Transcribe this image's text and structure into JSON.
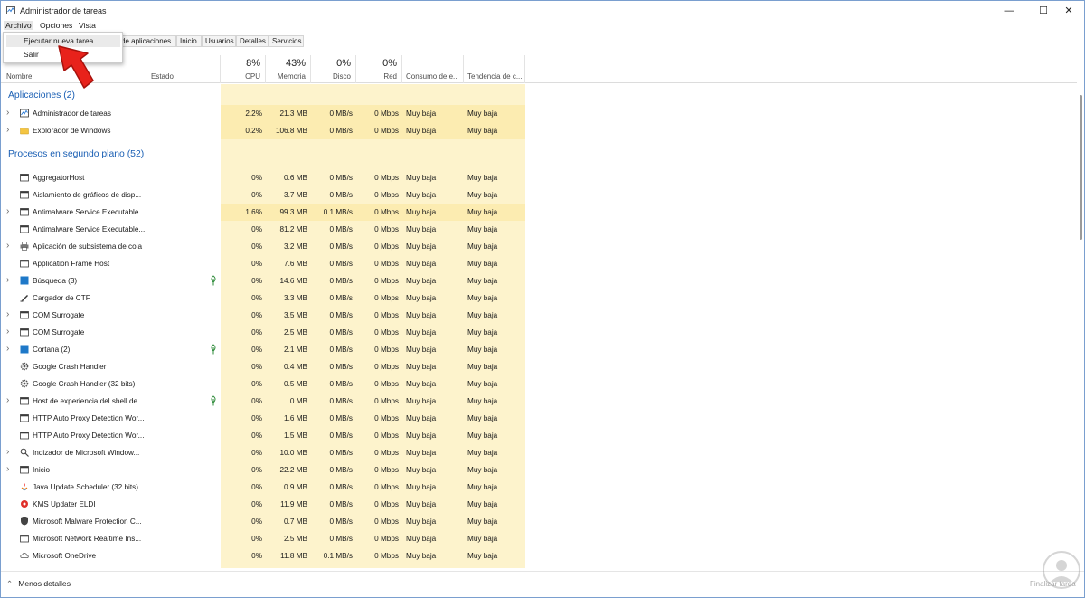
{
  "window": {
    "title": "Administrador de tareas"
  },
  "menubar": [
    "Archivo",
    "Opciones",
    "Vista"
  ],
  "dropdown": {
    "items": [
      "Ejecutar nueva tarea",
      "Salir"
    ]
  },
  "tabs": [
    "de aplicaciones",
    "Inicio",
    "Usuarios",
    "Detalles",
    "Servicios"
  ],
  "columns": {
    "name": "Nombre",
    "status": "Estado",
    "cpu": {
      "pct": "8%",
      "label": "CPU"
    },
    "mem": {
      "pct": "43%",
      "label": "Memoria"
    },
    "disk": {
      "pct": "0%",
      "label": "Disco"
    },
    "net": {
      "pct": "0%",
      "label": "Red"
    },
    "power": "Consumo de e...",
    "trend": "Tendencia de c..."
  },
  "sections": {
    "apps": "Aplicaciones (2)",
    "bg": "Procesos en segundo plano (52)"
  },
  "apps": [
    {
      "name": "Administrador de tareas",
      "cpu": "2.2%",
      "mem": "21.3 MB",
      "disk": "0 MB/s",
      "net": "0 Mbps",
      "power": "Muy baja",
      "trend": "Muy baja",
      "icon": "task-manager-icon",
      "expand": true
    },
    {
      "name": "Explorador de Windows",
      "cpu": "0.2%",
      "mem": "106.8 MB",
      "disk": "0 MB/s",
      "net": "0 Mbps",
      "power": "Muy baja",
      "trend": "Muy baja",
      "icon": "folder-icon",
      "expand": true
    }
  ],
  "bg": [
    {
      "name": "AggregatorHost",
      "cpu": "0%",
      "mem": "0.6 MB",
      "disk": "0 MB/s",
      "net": "0 Mbps",
      "power": "Muy baja",
      "trend": "Muy baja",
      "icon": "app-window-icon",
      "expand": false
    },
    {
      "name": "Aislamiento de gráficos de disp...",
      "cpu": "0%",
      "mem": "3.7 MB",
      "disk": "0 MB/s",
      "net": "0 Mbps",
      "power": "Muy baja",
      "trend": "Muy baja",
      "icon": "app-window-icon",
      "expand": false
    },
    {
      "name": "Antimalware Service Executable",
      "cpu": "1.6%",
      "mem": "99.3 MB",
      "disk": "0.1 MB/s",
      "net": "0 Mbps",
      "power": "Muy baja",
      "trend": "Muy baja",
      "icon": "app-window-icon",
      "expand": true
    },
    {
      "name": "Antimalware Service Executable...",
      "cpu": "0%",
      "mem": "81.2 MB",
      "disk": "0 MB/s",
      "net": "0 Mbps",
      "power": "Muy baja",
      "trend": "Muy baja",
      "icon": "app-window-icon",
      "expand": false
    },
    {
      "name": "Aplicación de subsistema de cola",
      "cpu": "0%",
      "mem": "3.2 MB",
      "disk": "0 MB/s",
      "net": "0 Mbps",
      "power": "Muy baja",
      "trend": "Muy baja",
      "icon": "printer-icon",
      "expand": true
    },
    {
      "name": "Application Frame Host",
      "cpu": "0%",
      "mem": "7.6 MB",
      "disk": "0 MB/s",
      "net": "0 Mbps",
      "power": "Muy baja",
      "trend": "Muy baja",
      "icon": "app-window-icon",
      "expand": false
    },
    {
      "name": "Búsqueda (3)",
      "cpu": "0%",
      "mem": "14.6 MB",
      "disk": "0 MB/s",
      "net": "0 Mbps",
      "power": "Muy baja",
      "trend": "Muy baja",
      "icon": "blue-tile-icon",
      "expand": true,
      "leaf": true
    },
    {
      "name": "Cargador de CTF",
      "cpu": "0%",
      "mem": "3.3 MB",
      "disk": "0 MB/s",
      "net": "0 Mbps",
      "power": "Muy baja",
      "trend": "Muy baja",
      "icon": "pen-icon",
      "expand": false
    },
    {
      "name": "COM Surrogate",
      "cpu": "0%",
      "mem": "3.5 MB",
      "disk": "0 MB/s",
      "net": "0 Mbps",
      "power": "Muy baja",
      "trend": "Muy baja",
      "icon": "app-window-icon",
      "expand": true
    },
    {
      "name": "COM Surrogate",
      "cpu": "0%",
      "mem": "2.5 MB",
      "disk": "0 MB/s",
      "net": "0 Mbps",
      "power": "Muy baja",
      "trend": "Muy baja",
      "icon": "app-window-icon",
      "expand": true
    },
    {
      "name": "Cortana (2)",
      "cpu": "0%",
      "mem": "2.1 MB",
      "disk": "0 MB/s",
      "net": "0 Mbps",
      "power": "Muy baja",
      "trend": "Muy baja",
      "icon": "blue-tile-icon",
      "expand": true,
      "leaf": true
    },
    {
      "name": "Google Crash Handler",
      "cpu": "0%",
      "mem": "0.4 MB",
      "disk": "0 MB/s",
      "net": "0 Mbps",
      "power": "Muy baja",
      "trend": "Muy baja",
      "icon": "gear-icon",
      "expand": false
    },
    {
      "name": "Google Crash Handler (32 bits)",
      "cpu": "0%",
      "mem": "0.5 MB",
      "disk": "0 MB/s",
      "net": "0 Mbps",
      "power": "Muy baja",
      "trend": "Muy baja",
      "icon": "gear-icon",
      "expand": false
    },
    {
      "name": "Host de experiencia del shell de ...",
      "cpu": "0%",
      "mem": "0 MB",
      "disk": "0 MB/s",
      "net": "0 Mbps",
      "power": "Muy baja",
      "trend": "Muy baja",
      "icon": "app-window-icon",
      "expand": true,
      "leaf": true
    },
    {
      "name": "HTTP Auto Proxy Detection Wor...",
      "cpu": "0%",
      "mem": "1.6 MB",
      "disk": "0 MB/s",
      "net": "0 Mbps",
      "power": "Muy baja",
      "trend": "Muy baja",
      "icon": "app-window-icon",
      "expand": false
    },
    {
      "name": "HTTP Auto Proxy Detection Wor...",
      "cpu": "0%",
      "mem": "1.5 MB",
      "disk": "0 MB/s",
      "net": "0 Mbps",
      "power": "Muy baja",
      "trend": "Muy baja",
      "icon": "app-window-icon",
      "expand": false
    },
    {
      "name": "Indizador de Microsoft Window...",
      "cpu": "0%",
      "mem": "10.0 MB",
      "disk": "0 MB/s",
      "net": "0 Mbps",
      "power": "Muy baja",
      "trend": "Muy baja",
      "icon": "search-index-icon",
      "expand": true
    },
    {
      "name": "Inicio",
      "cpu": "0%",
      "mem": "22.2 MB",
      "disk": "0 MB/s",
      "net": "0 Mbps",
      "power": "Muy baja",
      "trend": "Muy baja",
      "icon": "app-window-icon",
      "expand": true
    },
    {
      "name": "Java Update Scheduler (32 bits)",
      "cpu": "0%",
      "mem": "0.9 MB",
      "disk": "0 MB/s",
      "net": "0 Mbps",
      "power": "Muy baja",
      "trend": "Muy baja",
      "icon": "java-icon",
      "expand": false
    },
    {
      "name": "KMS Updater ELDI",
      "cpu": "0%",
      "mem": "11.9 MB",
      "disk": "0 MB/s",
      "net": "0 Mbps",
      "power": "Muy baja",
      "trend": "Muy baja",
      "icon": "red-dot-icon",
      "expand": false
    },
    {
      "name": "Microsoft Malware Protection C...",
      "cpu": "0%",
      "mem": "0.7 MB",
      "disk": "0 MB/s",
      "net": "0 Mbps",
      "power": "Muy baja",
      "trend": "Muy baja",
      "icon": "shield-icon",
      "expand": false
    },
    {
      "name": "Microsoft Network Realtime Ins...",
      "cpu": "0%",
      "mem": "2.5 MB",
      "disk": "0 MB/s",
      "net": "0 Mbps",
      "power": "Muy baja",
      "trend": "Muy baja",
      "icon": "app-window-icon",
      "expand": false
    },
    {
      "name": "Microsoft OneDrive",
      "cpu": "0%",
      "mem": "11.8 MB",
      "disk": "0.1 MB/s",
      "net": "0 Mbps",
      "power": "Muy baja",
      "trend": "Muy baja",
      "icon": "cloud-icon",
      "expand": false
    }
  ],
  "footer": {
    "less_details": "Menos detalles",
    "end_task": "Finalizar tarea"
  },
  "colors": {
    "section": "#1a5fb4",
    "heat": "#fdf3cc",
    "heat_strong": "#fbe59a",
    "arrow": "#e8221b"
  }
}
